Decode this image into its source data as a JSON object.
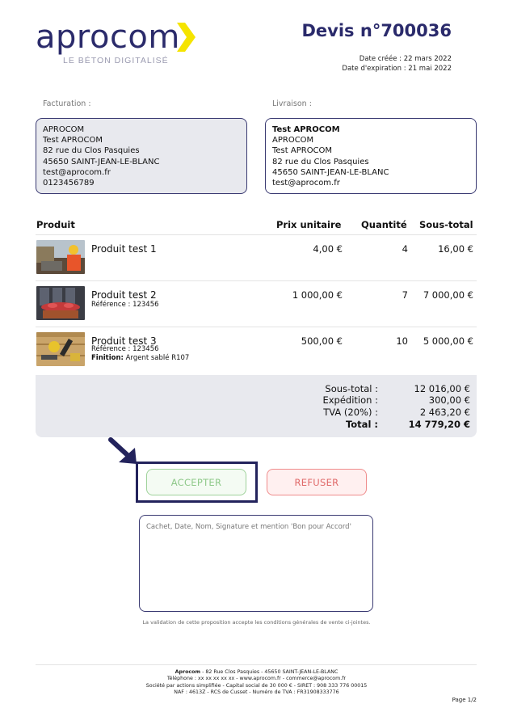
{
  "brand": {
    "logo_text": "aprocom",
    "tagline": "LE BÉTON DIGITALISÉ",
    "accent_color": "#f5e400",
    "navy_color": "#2a2a6b"
  },
  "quote": {
    "title": "Devis n°700036",
    "date_created": "Date créée : 22 mars 2022",
    "date_expiry": "Date d'expiration : 21 mai 2022"
  },
  "billing": {
    "label": "Facturation :",
    "lines": [
      "APROCOM",
      "Test APROCOM",
      "82 rue du Clos Pasquies",
      "45650 SAINT-JEAN-LE-BLANC",
      "test@aprocom.fr",
      "0123456789"
    ]
  },
  "shipping": {
    "label": "Livraison :",
    "lines": [
      "Test APROCOM",
      "APROCOM",
      "Test APROCOM",
      "82 rue du Clos Pasquies",
      "45650 SAINT-JEAN-LE-BLANC",
      "test@aprocom.fr"
    ]
  },
  "table": {
    "headers": {
      "product": "Produit",
      "unit_price": "Prix unitaire",
      "quantity": "Quantité",
      "subtotal": "Sous-total"
    },
    "rows": [
      {
        "name": "Produit test 1",
        "reference": "",
        "finish_label": "",
        "finish_value": "",
        "unit_price": "4,00 €",
        "quantity": "4",
        "subtotal": "16,00 €",
        "image_icon": "construction-worker-photo"
      },
      {
        "name": "Produit test 2",
        "reference": "Référence : 123456",
        "finish_label": "",
        "finish_value": "",
        "unit_price": "1 000,00 €",
        "quantity": "7",
        "subtotal": "7 000,00 €",
        "image_icon": "flower-box-photo"
      },
      {
        "name": "Produit test 3",
        "reference": "Référence : 123456",
        "finish_label": "Finition:",
        "finish_value": " Argent sablé R107",
        "unit_price": "500,00 €",
        "quantity": "10",
        "subtotal": "5 000,00 €",
        "image_icon": "tools-on-wood-photo"
      }
    ]
  },
  "totals": {
    "subtotal_label": "Sous-total :",
    "subtotal": "12 016,00 €",
    "shipping_label": "Expédition :",
    "shipping": "300,00 €",
    "tax_label": "TVA (20%) :",
    "tax": "2 463,20 €",
    "total_label": "Total :",
    "total": "14 779,20 €"
  },
  "actions": {
    "accept_label": "ACCEPTER",
    "refuse_label": "REFUSER",
    "accept_color": "#8fc98a",
    "refuse_color": "#e06a6a"
  },
  "signature": {
    "placeholder": "Cachet, Date, Nom, Signature et mention 'Bon pour Accord'"
  },
  "validation_note": "La validation de cette proposition accepte les conditions générales de vente ci-jointes.",
  "footer": {
    "company": "Aprocom",
    "line1_rest": " - 82 Rue Clos Pasquies - 45650 SAINT-JEAN-LE-BLANC",
    "line2": "Téléphone : xx xx xx xx xx - www.aprocom.fr - commerce@aprocom.fr",
    "line3": "Société par actions simplifiée - Capital social de 30 000 € - SIRET : 908 333 776 00015",
    "line4": "NAF : 4613Z - RCS de Cusset - Numéro de TVA : FR31908333776",
    "page": "Page 1/2"
  }
}
